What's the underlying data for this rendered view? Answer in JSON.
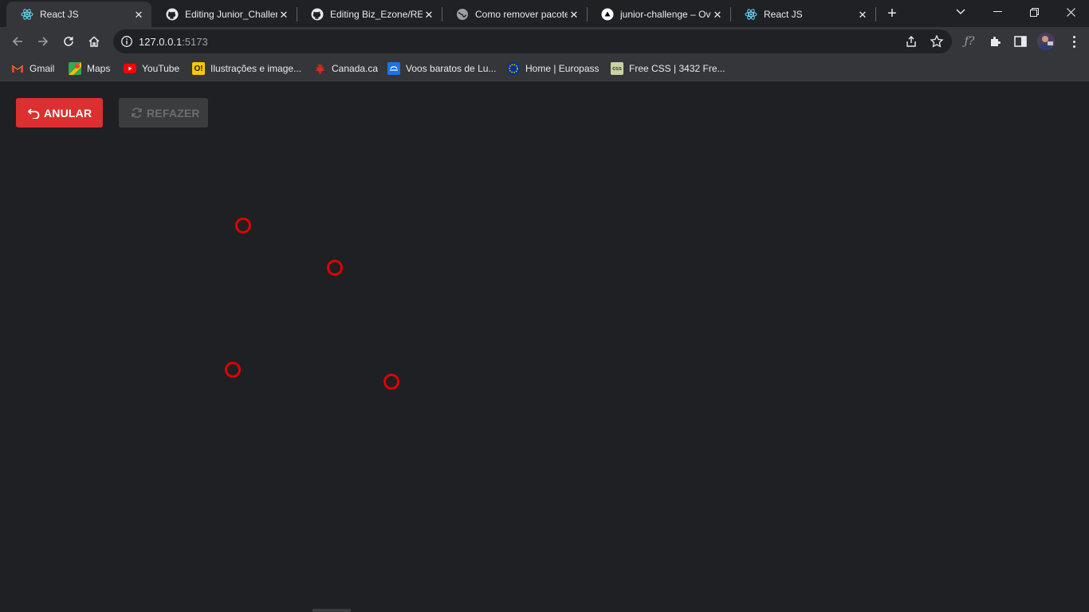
{
  "browser": {
    "tabs": [
      {
        "title": "React JS",
        "icon": "react-icon",
        "active": true
      },
      {
        "title": "Editing Junior_Challen",
        "icon": "github-icon",
        "active": false
      },
      {
        "title": "Editing Biz_Ezone/REA",
        "icon": "github-icon",
        "active": false
      },
      {
        "title": "Como remover pacote",
        "icon": "globe-icon",
        "active": false
      },
      {
        "title": "junior-challenge – Ove",
        "icon": "vercel-icon",
        "active": false
      },
      {
        "title": "React JS",
        "icon": "react-icon",
        "active": false
      }
    ],
    "address": {
      "host": "127.0.0.1",
      "port": ":5173"
    },
    "bookmarks": [
      {
        "label": "Gmail",
        "icon": "gmail-icon",
        "color": "#ea4335"
      },
      {
        "label": "Maps",
        "icon": "maps-icon",
        "color": "#34a853"
      },
      {
        "label": "YouTube",
        "icon": "youtube-icon",
        "color": "#ff0000"
      },
      {
        "label": "Ilustrações e image...",
        "icon": "illustration-icon",
        "color": "#f9c800"
      },
      {
        "label": "Canada.ca",
        "icon": "maple-leaf-icon",
        "color": "#d52b1e"
      },
      {
        "label": "Voos baratos de Lu...",
        "icon": "flight-icon",
        "color": "#1a73e8"
      },
      {
        "label": "Home | Europass",
        "icon": "europass-icon",
        "color": "#003399"
      },
      {
        "label": "Free CSS | 3432 Fre...",
        "icon": "freecss-icon",
        "color": "#c7d3a0"
      }
    ]
  },
  "app": {
    "undo_label": "ANULAR",
    "redo_label": "REFAZER",
    "accent": "#dc2f2f",
    "dot_color": "#e00000",
    "dot_count": 4
  }
}
